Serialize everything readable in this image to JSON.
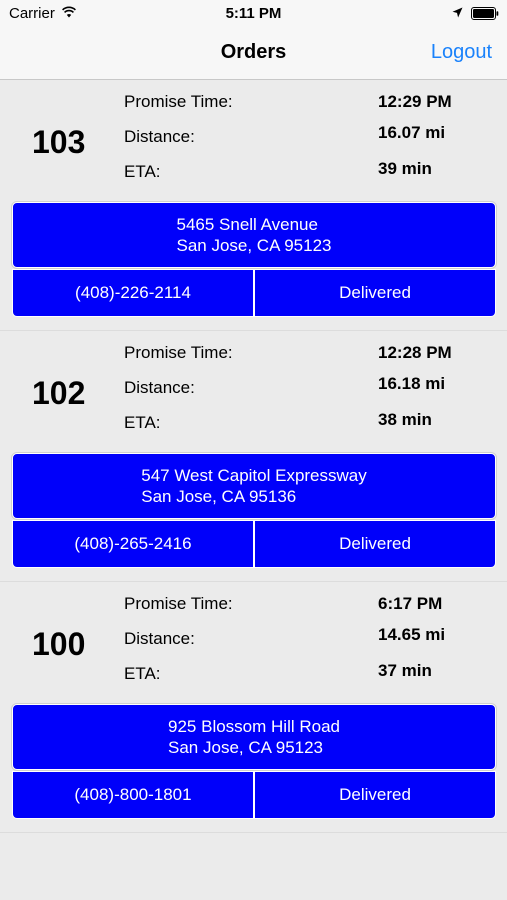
{
  "status_bar": {
    "carrier": "Carrier",
    "time": "5:11 PM"
  },
  "nav": {
    "title": "Orders",
    "logout_label": "Logout"
  },
  "labels": {
    "promise_time": "Promise Time:",
    "distance": "Distance:",
    "eta": "ETA:"
  },
  "orders": [
    {
      "number": "103",
      "promise_time": "12:29 PM",
      "distance": "16.07 mi",
      "eta": "39 min",
      "address_line1": "5465 Snell Avenue",
      "address_line2": "San Jose, CA 95123",
      "phone": "(408)-226-2114",
      "status": "Delivered"
    },
    {
      "number": "102",
      "promise_time": "12:28 PM",
      "distance": "16.18 mi",
      "eta": "38 min",
      "address_line1": "547 West Capitol Expressway",
      "address_line2": "San Jose, CA 95136",
      "phone": "(408)-265-2416",
      "status": "Delivered"
    },
    {
      "number": "100",
      "promise_time": "6:17 PM",
      "distance": "14.65 mi",
      "eta": "37 min",
      "address_line1": "925 Blossom Hill Road",
      "address_line2": "San Jose, CA 95123",
      "phone": "(408)-800-1801",
      "status": "Delivered"
    }
  ],
  "colors": {
    "button_blue": "#0000fa",
    "link_blue": "#1a82fb",
    "background": "#ebebeb"
  }
}
